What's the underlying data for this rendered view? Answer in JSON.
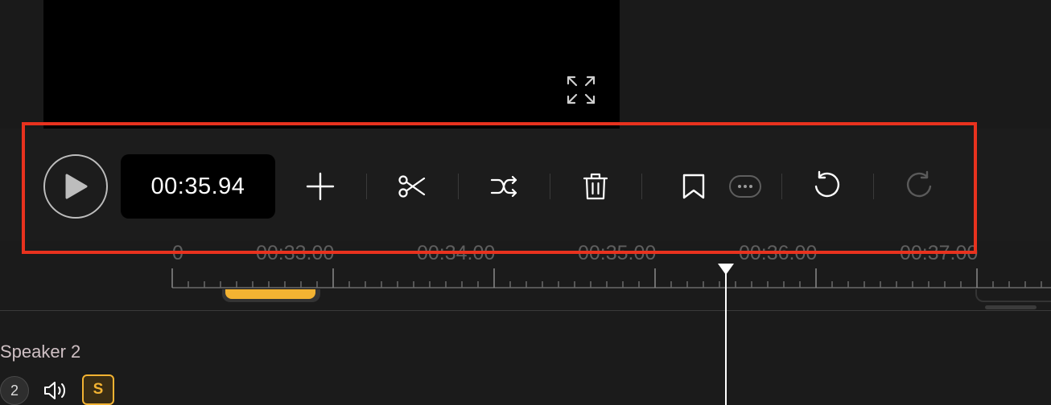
{
  "player": {
    "timecode": "00:35.94"
  },
  "toolbar": {
    "tools": [
      {
        "name": "add",
        "icon": "plus-icon"
      },
      {
        "name": "split",
        "icon": "scissors-icon"
      },
      {
        "name": "swap",
        "icon": "swap-arrows-icon"
      },
      {
        "name": "delete",
        "icon": "trash-icon"
      },
      {
        "name": "bookmark",
        "icon": "bookmark-icon"
      },
      {
        "name": "more",
        "icon": "ellipsis-icon"
      },
      {
        "name": "undo",
        "icon": "undo-icon"
      },
      {
        "name": "redo",
        "icon": "redo-icon",
        "disabled": true
      }
    ]
  },
  "timeline": {
    "ticks": [
      "0",
      "00:33.00",
      "00:34.00",
      "00:35.00",
      "00:36.00",
      "00:37.00"
    ]
  },
  "track": {
    "speaker_label": "Speaker 2",
    "speaker_number": "2",
    "solo_label": "S"
  },
  "colors": {
    "accent": "#f3b332",
    "highlight": "#e8321e",
    "background": "#1b1b1b"
  }
}
